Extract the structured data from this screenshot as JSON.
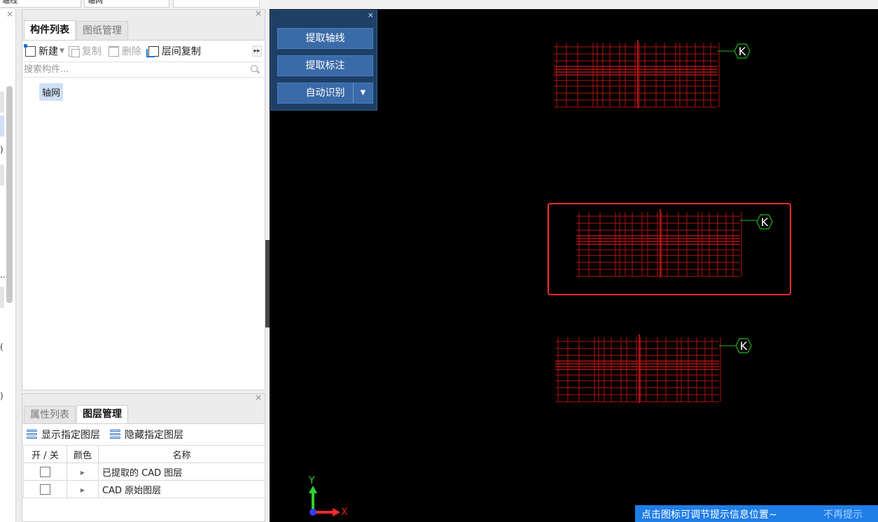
{
  "top_fields": [
    "轴线",
    "轴网",
    ""
  ],
  "left_panel": {
    "close_label": "×",
    "fragments": [
      ")",
      "..",
      "(",
      ")"
    ]
  },
  "component_panel": {
    "close_label": "×",
    "tabs": [
      {
        "label": "构件列表",
        "active": true
      },
      {
        "label": "图纸管理",
        "active": false
      }
    ],
    "toolbar": {
      "new_label": "新建",
      "copy_label": "复制",
      "delete_label": "删除",
      "floor_copy_label": "层间复制",
      "more_label": "▸▸"
    },
    "search_placeholder": "搜索构件...",
    "tree_items": [
      "轴网"
    ]
  },
  "layer_panel": {
    "close_label": "×",
    "tabs": [
      {
        "label": "属性列表",
        "active": false
      },
      {
        "label": "图层管理",
        "active": true
      }
    ],
    "show_label": "显示指定图层",
    "hide_label": "隐藏指定图层",
    "columns": [
      "开 / 关",
      "颜色",
      "名称"
    ],
    "rows": [
      {
        "checked": false,
        "name": "已提取的 CAD 图层"
      },
      {
        "checked": false,
        "name": "CAD 原始图层"
      }
    ]
  },
  "palette": {
    "close_label": "×",
    "extract_axis_label": "提取轴线",
    "extract_dim_label": "提取标注",
    "auto_recognize_label": "自动识别",
    "dropdown_arrow": "▼"
  },
  "canvas": {
    "axis_bubble_label": "K",
    "axis_x_label": "X",
    "axis_y_label": "Y",
    "drawing_color": "#b31212",
    "bubble_color": "#18b818",
    "selection_color": "#ff2a2a"
  },
  "hint": {
    "message": "点击图标可调节提示信息位置~",
    "dismiss_label": "不再提示"
  }
}
